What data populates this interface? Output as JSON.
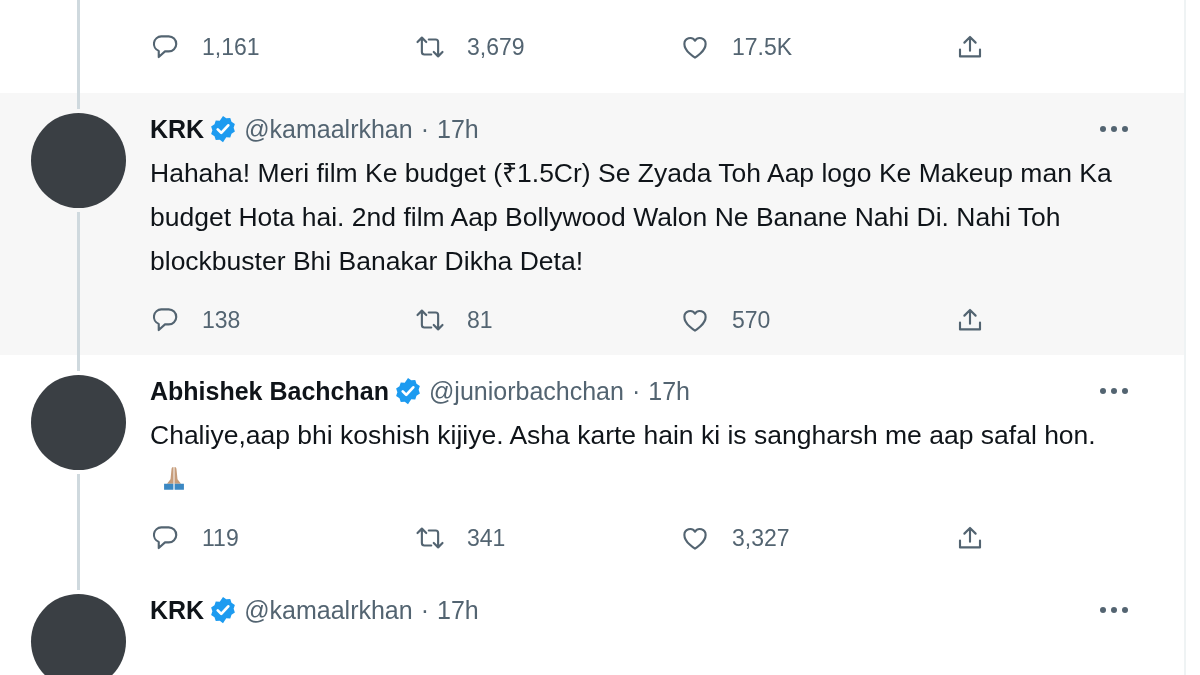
{
  "previous_tweet": {
    "actions": {
      "replies": "1,161",
      "retweets": "3,679",
      "likes": "17.5K"
    }
  },
  "tweets": [
    {
      "name": "KRK",
      "verified": true,
      "handle": "@kamaalrkhan",
      "separator": "·",
      "time": "17h",
      "highlighted": true,
      "thread_below": true,
      "text": "Hahaha! Meri film Ke budget (₹1.5Cr) Se Zyada Toh Aap logo Ke Makeup man Ka budget Hota hai. 2nd film Aap Bollywood Walon Ne Banane Nahi Di. Nahi Toh blockbuster Bhi Banakar Dikha Deta!",
      "emoji": false,
      "actions": {
        "replies": "138",
        "retweets": "81",
        "likes": "570"
      }
    },
    {
      "name": "Abhishek Bachchan",
      "verified": true,
      "handle": "@juniorbachchan",
      "separator": "·",
      "time": "17h",
      "highlighted": false,
      "thread_below": true,
      "text": "Chaliye,aap bhi koshish kijiye. Asha karte hain ki is sangharsh me aap safal hon.",
      "emoji": true,
      "actions": {
        "replies": "119",
        "retweets": "341",
        "likes": "3,327"
      }
    },
    {
      "name": "KRK",
      "verified": true,
      "handle": "@kamaalrkhan",
      "separator": "·",
      "time": "17h",
      "highlighted": false
    }
  ]
}
